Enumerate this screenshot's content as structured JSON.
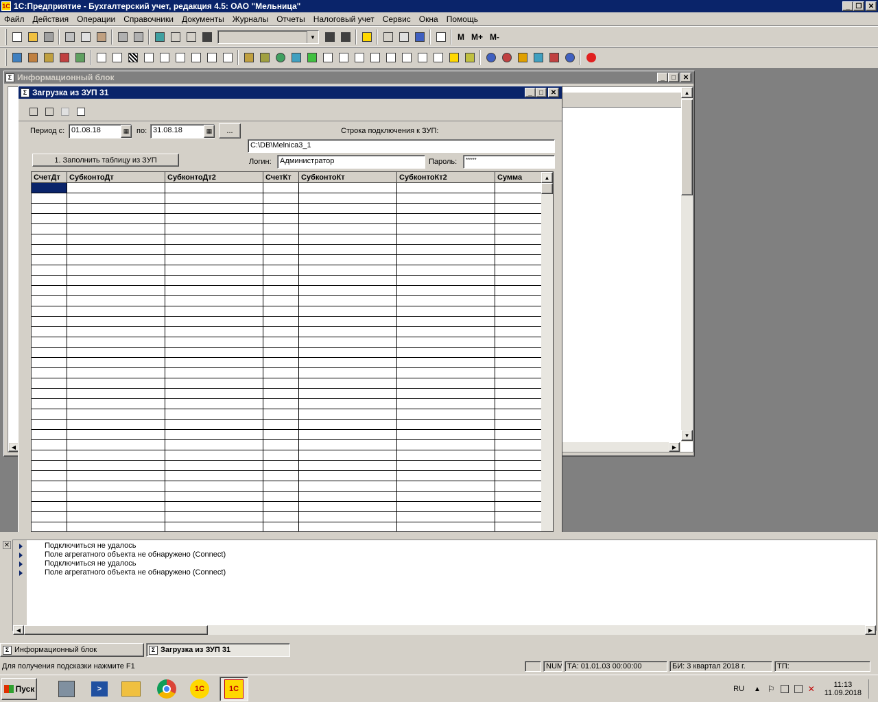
{
  "app": {
    "title": "1С:Предприятие - Бухгалтерский учет, редакция 4.5: ОАО \"Мельница\"",
    "logo": "1С"
  },
  "menu": {
    "items": [
      "Файл",
      "Действия",
      "Операции",
      "Справочники",
      "Документы",
      "Журналы",
      "Отчеты",
      "Налоговый учет",
      "Сервис",
      "Окна",
      "Помощь"
    ]
  },
  "toolbar": {
    "m_label": "M",
    "mplus_label": "M+",
    "mminus_label": "M-"
  },
  "info_window": {
    "title": "Информационный блок"
  },
  "load_window": {
    "title": "Загрузка из ЗУП 31",
    "period_from_label": "Период с:",
    "period_from_value": "01.08.18",
    "period_to_label": "по:",
    "period_to_value": "31.08.18",
    "ellipsis_label": "...",
    "connection_label": "Строка подключения к ЗУП:",
    "connection_value": "C:\\DB\\Melnica3_1",
    "fill_button_label": "1. Заполнить таблицу из ЗУП",
    "login_label": "Логин:",
    "login_value": "Администратор",
    "password_label": "Пароль:",
    "password_value": "*****"
  },
  "grid": {
    "columns": [
      "СчетДт",
      "СубконтоДт",
      "СубконтоДт2",
      "СчетКт",
      "СубконтоКт",
      "СубконтоКт2",
      "Сумма"
    ]
  },
  "messages": [
    "Подключиться не удалось",
    "Поле агрегатного объекта не обнаружено (Connect)",
    "Подключиться не удалось",
    "Поле агрегатного объекта не обнаружено (Connect)"
  ],
  "window_tabs": {
    "info": "Информационный блок",
    "load": "Загрузка из ЗУП 31"
  },
  "status": {
    "hint": "Для получения подсказки нажмите F1",
    "num": "NUM",
    "ta": "ТА: 01.01.03  00:00:00",
    "bi": "БИ: 3 квартал 2018 г.",
    "tp": "ТП:"
  },
  "taskbar": {
    "start_label": "Пуск",
    "language": "RU",
    "time": "11:13",
    "date": "11.09.2018"
  }
}
